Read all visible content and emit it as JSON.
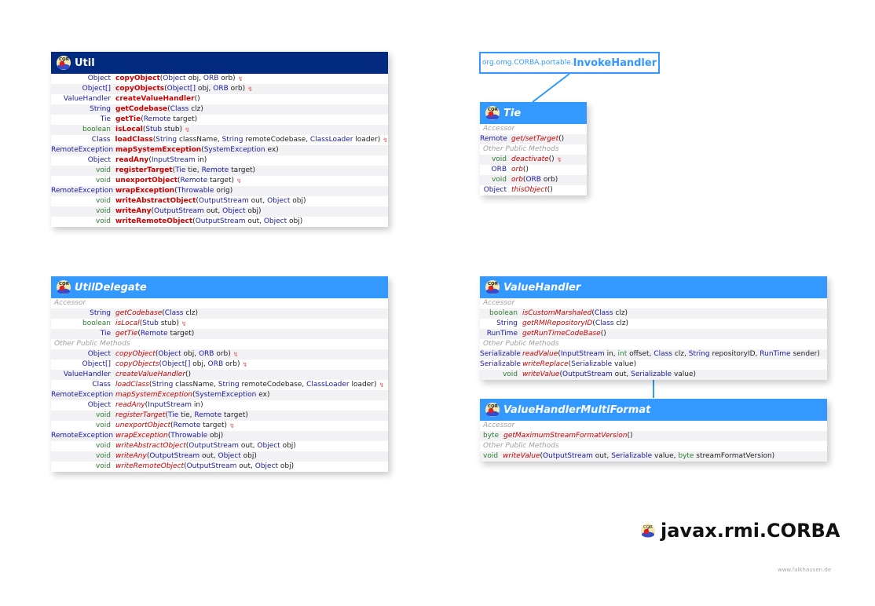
{
  "package": {
    "name": "javax.rmi.CORBA",
    "icon": "corba-package-icon"
  },
  "credit": "www.falkhausen.de",
  "colors": {
    "header_class": "#022a7e",
    "header_interface": "#3399ff",
    "method_name": "#cc0000",
    "type": "#1a1aa6",
    "primitive": "#2e7d32"
  },
  "external": {
    "package": "org.omg.CORBA.portable.",
    "name": "InvokeHandler"
  },
  "util": {
    "title": "Util",
    "rows": [
      {
        "ret": "Object",
        "rc": "t-blue",
        "name": "copyObject",
        "params": [
          [
            "Object",
            "t-blue"
          ],
          [
            " obj, ",
            "txt"
          ],
          [
            "ORB",
            "t-blue"
          ],
          [
            " orb)",
            "txt"
          ]
        ],
        "mark": true
      },
      {
        "ret": "Object[]",
        "rc": "t-blue",
        "name": "copyObjects",
        "params": [
          [
            "Object[]",
            "t-blue"
          ],
          [
            " obj, ",
            "txt"
          ],
          [
            "ORB",
            "t-blue"
          ],
          [
            " orb)",
            "txt"
          ]
        ],
        "mark": true
      },
      {
        "ret": "ValueHandler",
        "rc": "t-blue",
        "name": "createValueHandler",
        "params": [
          [
            "()",
            "txt"
          ]
        ]
      },
      {
        "ret": "String",
        "rc": "t-blue",
        "name": "getCodebase",
        "params": [
          [
            "Class",
            "t-blue"
          ],
          [
            " clz)",
            "txt"
          ]
        ]
      },
      {
        "ret": "Tie",
        "rc": "t-blue",
        "name": "getTie",
        "params": [
          [
            "Remote",
            "t-blue"
          ],
          [
            " target)",
            "txt"
          ]
        ]
      },
      {
        "ret": "boolean",
        "rc": "t-green",
        "name": "isLocal",
        "params": [
          [
            "Stub",
            "t-blue"
          ],
          [
            " stub)",
            "txt"
          ]
        ],
        "mark": true
      },
      {
        "ret": "Class",
        "rc": "t-blue",
        "name": "loadClass",
        "params": [
          [
            "String",
            "t-blue"
          ],
          [
            " className, ",
            "txt"
          ],
          [
            "String",
            "t-blue"
          ],
          [
            " remoteCodebase, ",
            "txt"
          ],
          [
            "ClassLoader",
            "t-blue"
          ],
          [
            " loader)",
            "txt"
          ]
        ],
        "mark": true
      },
      {
        "ret": "RemoteException",
        "rc": "t-blue",
        "name": "mapSystemException",
        "params": [
          [
            "SystemException",
            "t-blue"
          ],
          [
            " ex)",
            "txt"
          ]
        ]
      },
      {
        "ret": "Object",
        "rc": "t-blue",
        "name": "readAny",
        "params": [
          [
            "InputStream",
            "t-blue"
          ],
          [
            " in)",
            "txt"
          ]
        ]
      },
      {
        "ret": "void",
        "rc": "t-green",
        "name": "registerTarget",
        "params": [
          [
            "Tie",
            "t-blue"
          ],
          [
            " tie, ",
            "txt"
          ],
          [
            "Remote",
            "t-blue"
          ],
          [
            " target)",
            "txt"
          ]
        ]
      },
      {
        "ret": "void",
        "rc": "t-green",
        "name": "unexportObject",
        "params": [
          [
            "Remote",
            "t-blue"
          ],
          [
            " target)",
            "txt"
          ]
        ],
        "mark": true
      },
      {
        "ret": "RemoteException",
        "rc": "t-blue",
        "name": "wrapException",
        "params": [
          [
            "Throwable",
            "t-blue"
          ],
          [
            " orig)",
            "txt"
          ]
        ]
      },
      {
        "ret": "void",
        "rc": "t-green",
        "name": "writeAbstractObject",
        "params": [
          [
            "OutputStream",
            "t-blue"
          ],
          [
            " out, ",
            "txt"
          ],
          [
            "Object",
            "t-blue"
          ],
          [
            " obj)",
            "txt"
          ]
        ]
      },
      {
        "ret": "void",
        "rc": "t-green",
        "name": "writeAny",
        "params": [
          [
            "OutputStream",
            "t-blue"
          ],
          [
            " out, ",
            "txt"
          ],
          [
            "Object",
            "t-blue"
          ],
          [
            " obj)",
            "txt"
          ]
        ]
      },
      {
        "ret": "void",
        "rc": "t-green",
        "name": "writeRemoteObject",
        "params": [
          [
            "OutputStream",
            "t-blue"
          ],
          [
            " out, ",
            "txt"
          ],
          [
            "Object",
            "t-blue"
          ],
          [
            " obj)",
            "txt"
          ]
        ]
      }
    ]
  },
  "tie": {
    "title": "Tie",
    "rows": [
      {
        "section": "Accessor"
      },
      {
        "ret": "Remote",
        "rc": "t-blue",
        "name": "get/setTarget",
        "params": [
          [
            "()",
            "txt"
          ]
        ]
      },
      {
        "section": "Other Public Methods"
      },
      {
        "ret": "void",
        "rc": "t-green",
        "name": "deactivate",
        "params": [
          [
            "()",
            "txt"
          ]
        ],
        "mark": true
      },
      {
        "ret": "ORB",
        "rc": "t-blue",
        "name": "orb",
        "params": [
          [
            "()",
            "txt"
          ]
        ]
      },
      {
        "ret": "void",
        "rc": "t-green",
        "name": "orb",
        "params": [
          [
            "ORB",
            "t-blue"
          ],
          [
            " orb)",
            "txt"
          ]
        ]
      },
      {
        "ret": "Object",
        "rc": "t-blue",
        "name": "thisObject",
        "params": [
          [
            "()",
            "txt"
          ]
        ]
      }
    ]
  },
  "utilDelegate": {
    "title": "UtilDelegate",
    "rows": [
      {
        "section": "Accessor"
      },
      {
        "ret": "String",
        "rc": "t-blue",
        "name": "getCodebase",
        "params": [
          [
            "Class",
            "t-blue"
          ],
          [
            " clz)",
            "txt"
          ]
        ]
      },
      {
        "ret": "boolean",
        "rc": "t-green",
        "name": "isLocal",
        "params": [
          [
            "Stub",
            "t-blue"
          ],
          [
            " stub)",
            "txt"
          ]
        ],
        "mark": true
      },
      {
        "ret": "Tie",
        "rc": "t-blue",
        "name": "getTie",
        "params": [
          [
            "Remote",
            "t-blue"
          ],
          [
            " target)",
            "txt"
          ]
        ]
      },
      {
        "section": "Other Public Methods"
      },
      {
        "ret": "Object",
        "rc": "t-blue",
        "name": "copyObject",
        "params": [
          [
            "Object",
            "t-blue"
          ],
          [
            " obj, ",
            "txt"
          ],
          [
            "ORB",
            "t-blue"
          ],
          [
            " orb)",
            "txt"
          ]
        ],
        "mark": true
      },
      {
        "ret": "Object[]",
        "rc": "t-blue",
        "name": "copyObjects",
        "params": [
          [
            "Object[]",
            "t-blue"
          ],
          [
            " obj, ",
            "txt"
          ],
          [
            "ORB",
            "t-blue"
          ],
          [
            " orb)",
            "txt"
          ]
        ],
        "mark": true
      },
      {
        "ret": "ValueHandler",
        "rc": "t-blue",
        "name": "createValueHandler",
        "params": [
          [
            "()",
            "txt"
          ]
        ]
      },
      {
        "ret": "Class",
        "rc": "t-blue",
        "name": "loadClass",
        "params": [
          [
            "String",
            "t-blue"
          ],
          [
            " className, ",
            "txt"
          ],
          [
            "String",
            "t-blue"
          ],
          [
            " remoteCodebase, ",
            "txt"
          ],
          [
            "ClassLoader",
            "t-blue"
          ],
          [
            " loader)",
            "txt"
          ]
        ],
        "mark": true
      },
      {
        "ret": "RemoteException",
        "rc": "t-blue",
        "name": "mapSystemException",
        "params": [
          [
            "SystemException",
            "t-blue"
          ],
          [
            " ex)",
            "txt"
          ]
        ]
      },
      {
        "ret": "Object",
        "rc": "t-blue",
        "name": "readAny",
        "params": [
          [
            "InputStream",
            "t-blue"
          ],
          [
            " in)",
            "txt"
          ]
        ]
      },
      {
        "ret": "void",
        "rc": "t-green",
        "name": "registerTarget",
        "params": [
          [
            "Tie",
            "t-blue"
          ],
          [
            " tie, ",
            "txt"
          ],
          [
            "Remote",
            "t-blue"
          ],
          [
            " target)",
            "txt"
          ]
        ]
      },
      {
        "ret": "void",
        "rc": "t-green",
        "name": "unexportObject",
        "params": [
          [
            "Remote",
            "t-blue"
          ],
          [
            " target)",
            "txt"
          ]
        ],
        "mark": true
      },
      {
        "ret": "RemoteException",
        "rc": "t-blue",
        "name": "wrapException",
        "params": [
          [
            "Throwable",
            "t-blue"
          ],
          [
            " obj)",
            "txt"
          ]
        ]
      },
      {
        "ret": "void",
        "rc": "t-green",
        "name": "writeAbstractObject",
        "params": [
          [
            "OutputStream",
            "t-blue"
          ],
          [
            " out, ",
            "txt"
          ],
          [
            "Object",
            "t-blue"
          ],
          [
            " obj)",
            "txt"
          ]
        ]
      },
      {
        "ret": "void",
        "rc": "t-green",
        "name": "writeAny",
        "params": [
          [
            "OutputStream",
            "t-blue"
          ],
          [
            " out, ",
            "txt"
          ],
          [
            "Object",
            "t-blue"
          ],
          [
            " obj)",
            "txt"
          ]
        ]
      },
      {
        "ret": "void",
        "rc": "t-green",
        "name": "writeRemoteObject",
        "params": [
          [
            "OutputStream",
            "t-blue"
          ],
          [
            " out, ",
            "txt"
          ],
          [
            "Object",
            "t-blue"
          ],
          [
            " obj)",
            "txt"
          ]
        ]
      }
    ]
  },
  "valueHandler": {
    "title": "ValueHandler",
    "rows": [
      {
        "section": "Accessor"
      },
      {
        "ret": "boolean",
        "rc": "t-green",
        "name": "isCustomMarshaled",
        "params": [
          [
            "Class",
            "t-blue"
          ],
          [
            " clz)",
            "txt"
          ]
        ]
      },
      {
        "ret": "String",
        "rc": "t-blue",
        "name": "getRMIRepositoryID",
        "params": [
          [
            "Class",
            "t-blue"
          ],
          [
            " clz)",
            "txt"
          ]
        ]
      },
      {
        "ret": "RunTime",
        "rc": "t-blue",
        "name": "getRunTimeCodeBase",
        "params": [
          [
            "()",
            "txt"
          ]
        ]
      },
      {
        "section": "Other Public Methods"
      },
      {
        "ret": "Serializable",
        "rc": "t-blue",
        "name": "readValue",
        "params": [
          [
            "InputStream",
            "t-blue"
          ],
          [
            " in, ",
            "txt"
          ],
          [
            "int",
            "t-green"
          ],
          [
            " offset, ",
            "txt"
          ],
          [
            "Class",
            "t-blue"
          ],
          [
            " clz, ",
            "txt"
          ],
          [
            "String",
            "t-blue"
          ],
          [
            " repositoryID, ",
            "txt"
          ],
          [
            "RunTime",
            "t-blue"
          ],
          [
            " sender)",
            "txt"
          ]
        ]
      },
      {
        "ret": "Serializable",
        "rc": "t-blue",
        "name": "writeReplace",
        "params": [
          [
            "Serializable",
            "t-blue"
          ],
          [
            " value)",
            "txt"
          ]
        ]
      },
      {
        "ret": "void",
        "rc": "t-green",
        "name": "writeValue",
        "params": [
          [
            "OutputStream",
            "t-blue"
          ],
          [
            " out, ",
            "txt"
          ],
          [
            "Serializable",
            "t-blue"
          ],
          [
            " value)",
            "txt"
          ]
        ]
      }
    ]
  },
  "valueHandlerMultiFormat": {
    "title": "ValueHandlerMultiFormat",
    "rows": [
      {
        "section": "Accessor"
      },
      {
        "ret": "byte",
        "rc": "t-green",
        "name": "getMaximumStreamFormatVersion",
        "params": [
          [
            "()",
            "txt"
          ]
        ]
      },
      {
        "section": "Other Public Methods"
      },
      {
        "ret": "void",
        "rc": "t-green",
        "name": "writeValue",
        "params": [
          [
            "OutputStream",
            "t-blue"
          ],
          [
            " out, ",
            "txt"
          ],
          [
            "Serializable",
            "t-blue"
          ],
          [
            " value, ",
            "txt"
          ],
          [
            "byte",
            "t-green"
          ],
          [
            " streamFormatVersion)",
            "txt"
          ]
        ]
      }
    ]
  }
}
